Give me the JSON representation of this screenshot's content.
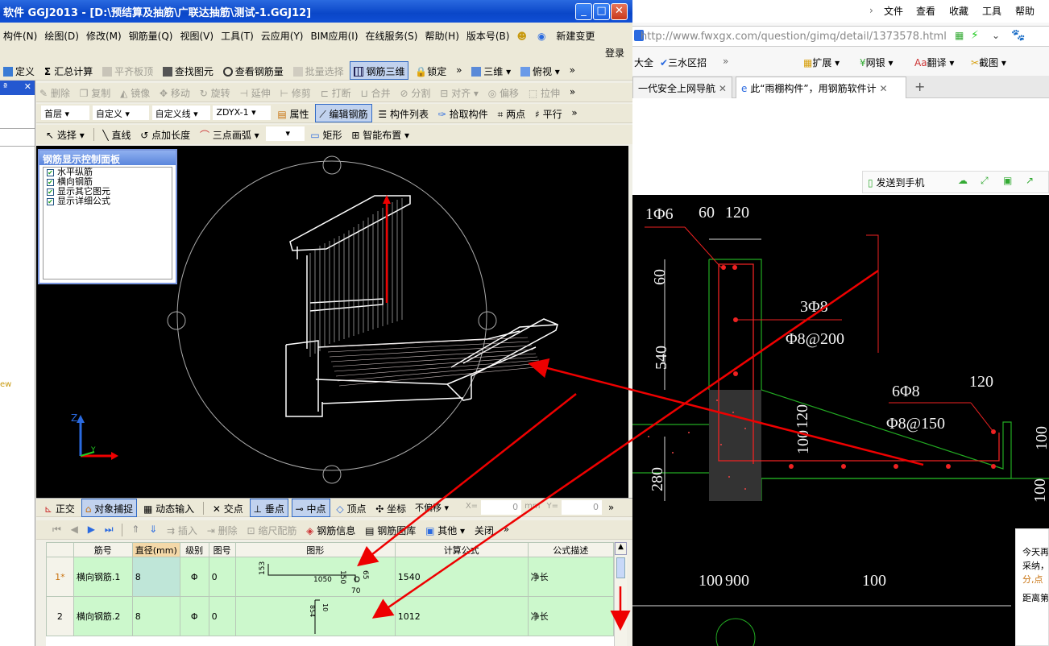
{
  "window": {
    "title": "软件 GGJ2013 - [D:\\预结算及抽筋\\广联达抽筋\\测试-1.GGJ12]",
    "min": "_",
    "max": "□",
    "close": "✕"
  },
  "menu": [
    "构件(N)",
    "绘图(D)",
    "修改(M)",
    "钢筋量(Q)",
    "视图(V)",
    "工具(T)",
    "云应用(Y)",
    "BIM应用(I)",
    "在线服务(S)",
    "帮助(H)",
    "版本号(B)",
    "新建变更"
  ],
  "login": "登录",
  "toolbar1": [
    "定义",
    "汇总计算",
    "平齐板顶",
    "查找图元",
    "查看钢筋量",
    "批量选择",
    "钢筋三维",
    "锁定",
    "三维",
    "俯视"
  ],
  "toolbar2": [
    "删除",
    "复制",
    "镜像",
    "移动",
    "旋转",
    "延伸",
    "修剪",
    "打断",
    "合并",
    "分割",
    "对齐",
    "偏移",
    "拉伸"
  ],
  "toolbar3": {
    "floor": "首层",
    "type1": "自定义",
    "type2": "自定义线",
    "code": "ZDYX-1",
    "btns": [
      "属性",
      "编辑钢筋",
      "构件列表",
      "拾取构件",
      "两点",
      "平行"
    ]
  },
  "toolbar4": [
    "选择",
    "直线",
    "点加长度",
    "三点画弧",
    "矩形",
    "智能布置"
  ],
  "panel": {
    "title": "钢筋显示控制面板",
    "items": [
      "水平纵筋",
      "横向钢筋",
      "显示其它图元",
      "显示详细公式"
    ]
  },
  "axis": {
    "z": "Z",
    "y": "Y"
  },
  "snapbar": [
    "正交",
    "对象捕捉",
    "动态输入",
    "交点",
    "垂点",
    "中点",
    "顶点",
    "坐标",
    "不偏移"
  ],
  "snap_x": "X=",
  "snap_y": "Y=",
  "snap_xv": "0",
  "snap_yv": "0",
  "snap_unit": "mm",
  "gridtoolbar": [
    "插入",
    "删除",
    "缩尺配筋",
    "钢筋信息",
    "钢筋图库",
    "其他",
    "关闭"
  ],
  "grid": {
    "headers": [
      "",
      "筋号",
      "直径(mm)",
      "级别",
      "图号",
      "图形",
      "计算公式",
      "公式描述"
    ],
    "rows": [
      {
        "idx": "1*",
        "name": "横向钢筋.1",
        "dia": "8",
        "grade": "Φ",
        "fig": "0",
        "formula": "1540",
        "desc": "净长",
        "shape": [
          "153",
          "1050",
          "150",
          "65",
          "70"
        ]
      },
      {
        "idx": "2",
        "name": "横向钢筋.2",
        "dia": "8",
        "grade": "Φ",
        "fig": "0",
        "formula": "1012",
        "desc": "净长",
        "shape": [
          "10",
          "854"
        ]
      }
    ]
  },
  "browser": {
    "menu": [
      "文件",
      "查看",
      "收藏",
      "工具",
      "帮助"
    ],
    "url": "http://www.fwxgx.com/question/gimq/detail/1373578.html",
    "bookmarks": [
      "大全",
      "三水区招",
      "扩展",
      "网银",
      "翻译",
      "截图"
    ],
    "tabs": [
      "一代安全上网导航",
      "此“雨棚构件”，用钢筋软件计"
    ],
    "send": "发送到手机",
    "side_text": [
      "今天再",
      "采纳，",
      "分,点",
      "距离第"
    ]
  },
  "cad": {
    "labels": [
      "1Φ6",
      "60",
      "120",
      "60",
      "540",
      "3Φ8",
      "Φ8@200",
      "6Φ8",
      "Φ8@150",
      "120",
      "120",
      "100",
      "280",
      "100",
      "100",
      "900",
      "100",
      "100"
    ]
  },
  "left_edge": "ew"
}
